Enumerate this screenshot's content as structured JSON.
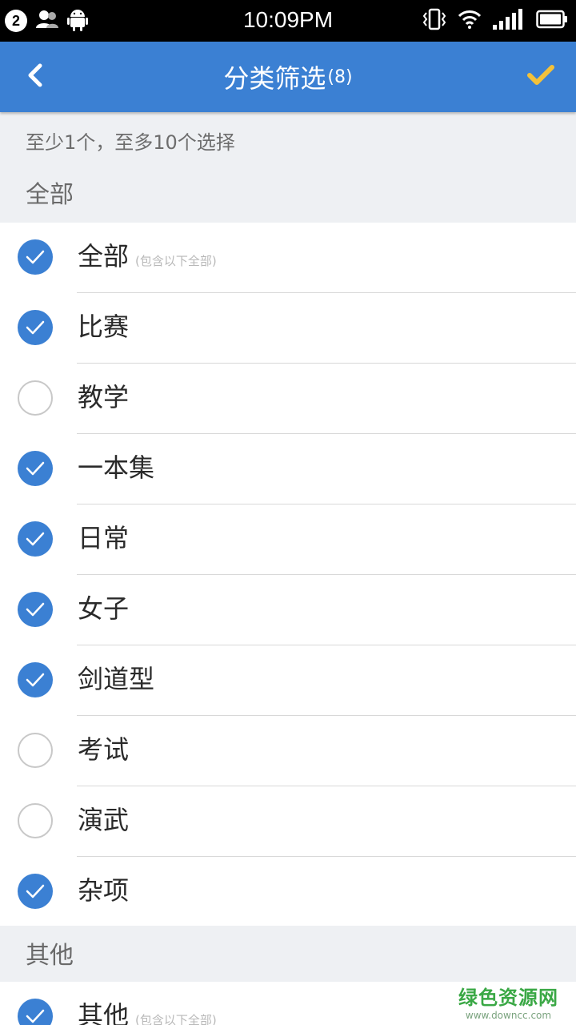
{
  "status_bar": {
    "notification_count": "2",
    "time": "10:09PM",
    "icons": [
      "contacts-icon",
      "android-icon",
      "vibrate-icon",
      "wifi-icon",
      "signal-icon",
      "battery-icon"
    ]
  },
  "app_bar": {
    "title": "分类筛选",
    "count": "(8)",
    "back_icon": "chevron-left-icon",
    "confirm_icon": "checkmark-icon",
    "accent_color": "#3b80d3",
    "confirm_color": "#f3c13a"
  },
  "hint": "至少1个，至多10个选择",
  "sections": [
    {
      "title": "全部",
      "items": [
        {
          "label": "全部",
          "note": "(包含以下全部)",
          "checked": true
        },
        {
          "label": "比赛",
          "checked": true
        },
        {
          "label": "教学",
          "checked": false
        },
        {
          "label": "一本集",
          "checked": true
        },
        {
          "label": "日常",
          "checked": true
        },
        {
          "label": "女子",
          "checked": true
        },
        {
          "label": "剑道型",
          "checked": true
        },
        {
          "label": "考试",
          "checked": false
        },
        {
          "label": "演武",
          "checked": false
        },
        {
          "label": "杂项",
          "checked": true
        }
      ]
    },
    {
      "title": "其他",
      "items": [
        {
          "label": "其他",
          "note": "(包含以下全部)",
          "checked": true
        }
      ]
    }
  ],
  "watermark": {
    "main": "绿色资源网",
    "sub": "www.downcc.com"
  }
}
